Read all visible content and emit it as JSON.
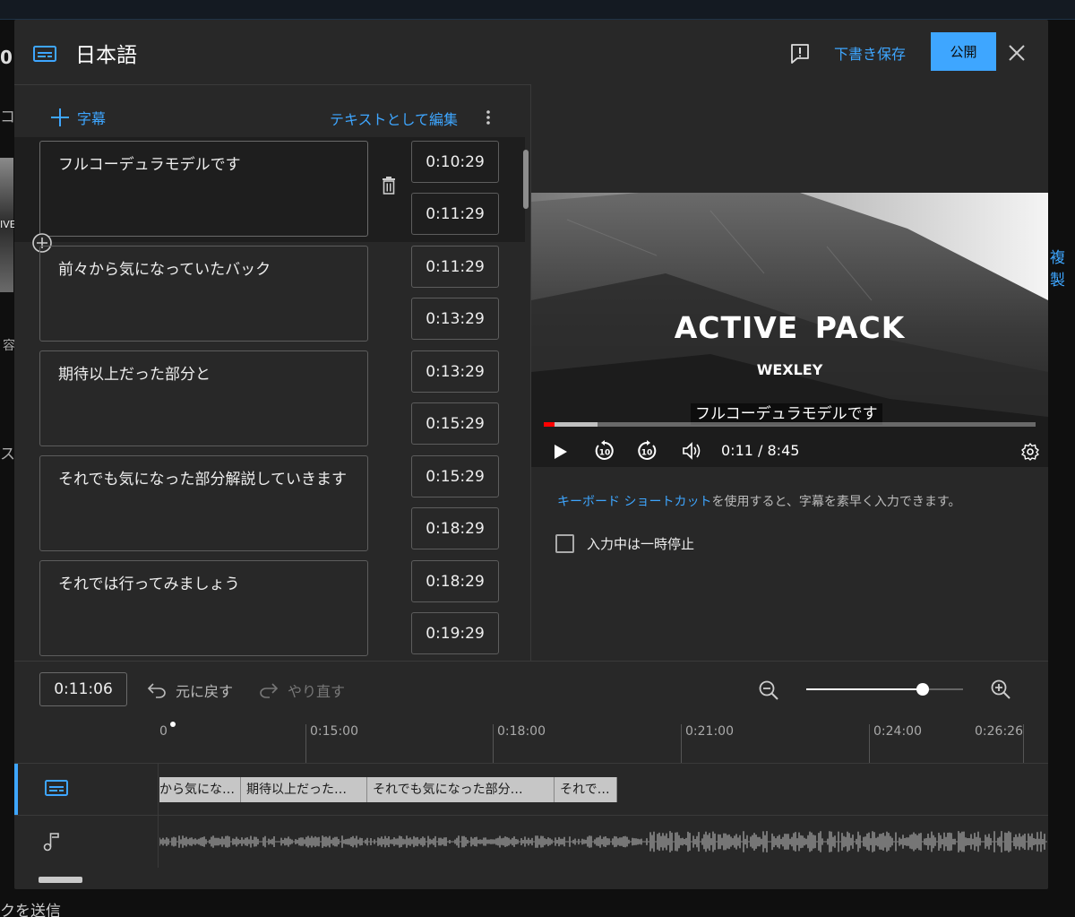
{
  "background": {
    "frag_left_top": "0",
    "frag_left_2": "コ",
    "frag_left_3": "IVE",
    "frag_left_4": "容",
    "frag_left_5": "ス",
    "right_link": "複製",
    "bottom_text": "クを送信"
  },
  "dialog": {
    "title": "日本語",
    "save_draft_label": "下書き保存",
    "publish_label": "公開"
  },
  "editor": {
    "add_caption_label": "字幕",
    "edit_as_text_label": "テキストとして編集",
    "captions": [
      {
        "text": "フルコーデュラモデルです",
        "start": "0:10:29",
        "end": "0:11:29",
        "active": true
      },
      {
        "text": "前々から気になっていたバック",
        "start": "0:11:29",
        "end": "0:13:29",
        "active": false
      },
      {
        "text": "期待以上だった部分と",
        "start": "0:13:29",
        "end": "0:15:29",
        "active": false
      },
      {
        "text": "それでも気になった部分解説していきます",
        "start": "0:15:29",
        "end": "0:18:29",
        "active": false
      },
      {
        "text": "それでは行ってみましょう",
        "start": "0:18:29",
        "end": "0:19:29",
        "active": false
      }
    ]
  },
  "preview": {
    "video_title": "ACTIVE PACK",
    "video_subtitle": "WEXLEY",
    "caption_overlay": "フルコーデュラモデルです",
    "time_readout": "0:11 / 8:45",
    "played_fraction": 0.022,
    "buffered_fraction": 0.11,
    "shortcut_link": "キーボード ショートカット",
    "shortcut_rest": "を使用すると、字幕を素早く入力できます。",
    "pause_while_typing_label": "入力中は一時停止",
    "pause_while_typing_checked": false
  },
  "timeline": {
    "current_time": "0:11:06",
    "undo_label": "元に戻す",
    "redo_label": "やり直す",
    "zoom_level_fraction": 0.74,
    "ruler_labels": [
      "0",
      "0:15:00",
      "0:18:00",
      "0:21:00",
      "0:24:00",
      "0:26:26"
    ],
    "segments": [
      "から気にな…",
      "期待以上だった…",
      "それでも気になった部分…",
      "それで…"
    ]
  },
  "colors": {
    "accent": "#3ea6ff",
    "dialog_bg": "#282828",
    "progress_played": "#ff0000"
  }
}
